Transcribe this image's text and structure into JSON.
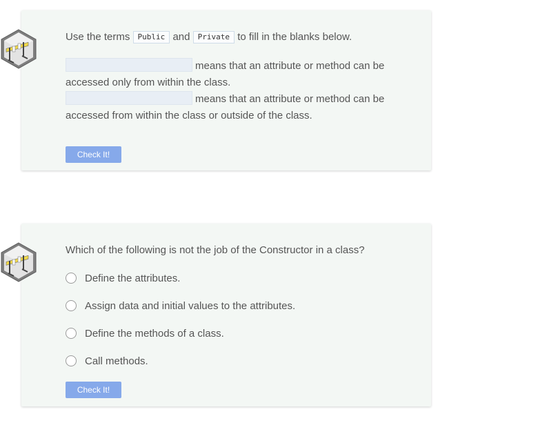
{
  "question1": {
    "prompt_before": "Use the terms",
    "term_public": "Public",
    "prompt_and": "and",
    "term_private": "Private",
    "prompt_after": "to fill in the blanks below.",
    "sentence1": "means that an attribute or method can be accessed only from within the class.",
    "sentence2": "means that an attribute or method can be accessed from within the class or outside of the class.",
    "blank1_value": "",
    "blank2_value": "",
    "check_label": "Check It!"
  },
  "question2": {
    "prompt": "Which of the following is not the job of the Constructor in a class?",
    "options": [
      "Define the attributes.",
      "Assign data and initial values to the attributes.",
      "Define the methods of a class.",
      "Call methods."
    ],
    "check_label": "Check It!"
  },
  "icons": {
    "badge": "challenge-hurdle-icon",
    "radio": "radio-unchecked-icon"
  },
  "colors": {
    "card_bg": "#f3f7f4",
    "button_bg": "#86a9ea",
    "blank_bg": "#e8eef5"
  }
}
